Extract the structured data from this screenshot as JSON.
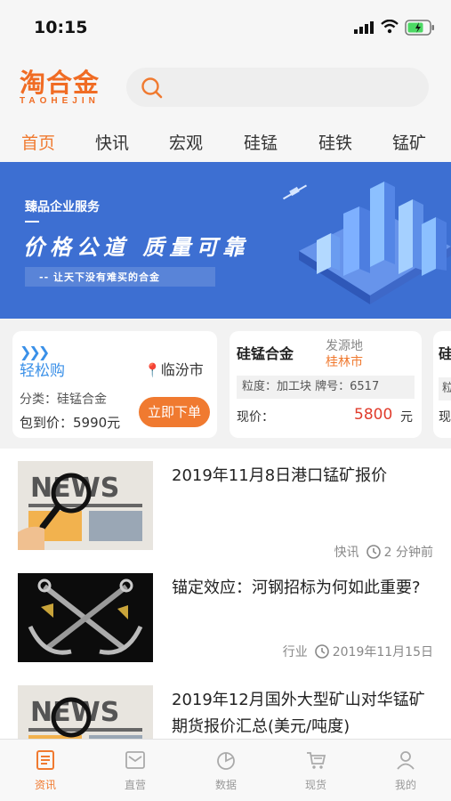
{
  "status_bar": {
    "time": "10:15"
  },
  "app": {
    "logo_cn": "淘合金",
    "logo_en": "TAOHEJIN",
    "accent_color": "#f07a30",
    "search": {
      "placeholder": ""
    }
  },
  "tabs": [
    {
      "label": "首页",
      "active": true
    },
    {
      "label": "快讯",
      "active": false
    },
    {
      "label": "宏观",
      "active": false
    },
    {
      "label": "硅锰",
      "active": false
    },
    {
      "label": "硅铁",
      "active": false
    },
    {
      "label": "锰矿",
      "active": false
    }
  ],
  "banner": {
    "tagline": "臻品企业服务",
    "headline": "价格公道 质量可靠",
    "subline": "-- 让天下没有难买的合金"
  },
  "cards": {
    "easy_buy": {
      "title": "轻松购",
      "location": "临汾市",
      "category": "分类：硅锰合金",
      "price": "包到价：5990元",
      "order_button": "立即下单"
    },
    "product": {
      "title": "硅锰合金",
      "origin_label": "发源地",
      "origin_value": "桂林市",
      "spec": "粒度：加工块  牌号：6517",
      "now_label": "现价：",
      "price": "5800",
      "unit": "元"
    },
    "partial": {
      "title": "硅",
      "spec": "粒",
      "now": "现"
    }
  },
  "news": [
    {
      "title": "2019年11月8日港口锰矿报价",
      "category": "快讯",
      "time": "2 分钟前",
      "thumb": "news-magnifier-icon"
    },
    {
      "title": "锚定效应：河钢招标为何如此重要?",
      "category": "行业",
      "time": "2019年11月15日",
      "thumb": "anchors-image"
    },
    {
      "title": "2019年12月国外大型矿山对华锰矿期货报价汇总(美元/吨度)",
      "category": "",
      "time": "",
      "thumb": "news-magnifier-icon"
    }
  ],
  "bottom_nav": [
    {
      "label": "资讯",
      "icon": "news-doc-icon",
      "active": true
    },
    {
      "label": "直营",
      "icon": "mail-icon",
      "active": false
    },
    {
      "label": "数据",
      "icon": "pie-chart-icon",
      "active": false
    },
    {
      "label": "现货",
      "icon": "cart-icon",
      "active": false
    },
    {
      "label": "我的",
      "icon": "user-icon",
      "active": false
    }
  ]
}
